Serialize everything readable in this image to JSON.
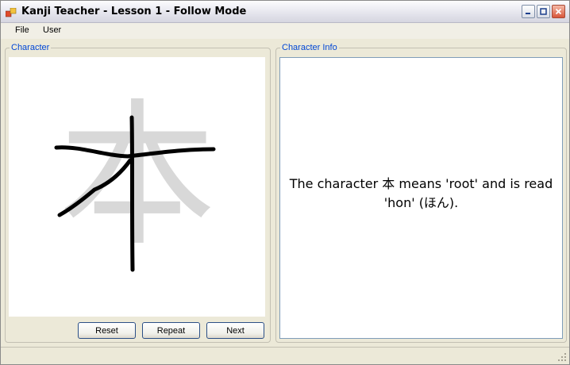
{
  "window": {
    "title": "Kanji Teacher - Lesson 1 - Follow Mode"
  },
  "menu": {
    "items": [
      "File",
      "User"
    ]
  },
  "character_group": {
    "legend": "Character",
    "guide_character": "本",
    "buttons": {
      "reset": "Reset",
      "repeat": "Repeat",
      "next": "Next"
    }
  },
  "info_group": {
    "legend": "Character Info",
    "text": "The character 本 means 'root' and is read 'hon' (ほん)."
  },
  "colors": {
    "legend": "#0046d5",
    "guide_glyph": "#d8d8d8",
    "stroke": "#000000"
  }
}
